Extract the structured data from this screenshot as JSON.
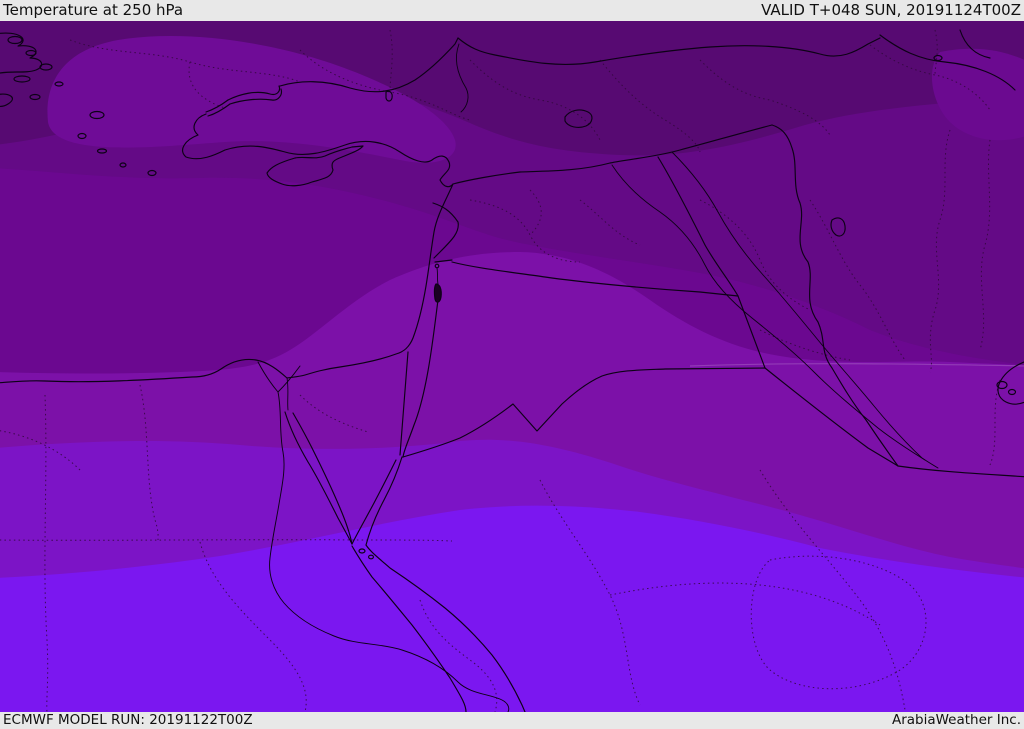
{
  "header": {
    "title": "Temperature at 250 hPa",
    "valid_label": "VALID T+048 SUN, 20191124T00Z"
  },
  "footer": {
    "model_run_label": "ECMWF MODEL RUN: 20191122T00Z",
    "provider_label": "ArabiaWeather Inc."
  },
  "map": {
    "description": "ECMWF 250 hPa temperature filled-contour forecast map covering the eastern Mediterranean, Turkey, the Levant, Egypt, Iraq and northern Saudi Arabia. Temperature shading ranges from dark purple (coldest, north) to bright blue-violet (south).",
    "bar_bg": "#e8e8e8",
    "text_color": "#111111",
    "temperature_bands": [
      {
        "name": "band-coldest-north",
        "color": "#570a72"
      },
      {
        "name": "band-dark",
        "color": "#640a86"
      },
      {
        "name": "band-medium",
        "color": "#6b0890"
      },
      {
        "name": "patch-nw-turkey",
        "color": "#6f0c97"
      },
      {
        "name": "patch-ne-corner",
        "color": "#6b0a90"
      },
      {
        "name": "band-light-levant",
        "color": "#7c11a8"
      },
      {
        "name": "band-lighter",
        "color": "#7c14c6"
      },
      {
        "name": "band-bright-south",
        "color": "#7b17f0"
      }
    ],
    "line_colors": {
      "coast": "#0d0116",
      "admin": "#30083a",
      "contour_hint": "rgba(255,255,255,0.18)"
    }
  }
}
